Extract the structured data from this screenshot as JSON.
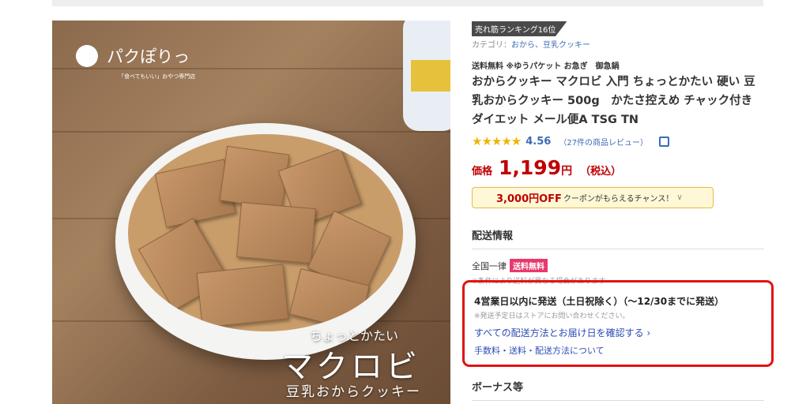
{
  "image": {
    "brand_name": "パクぽりっ",
    "brand_sub": "「食べてもいい」おやつ専門店",
    "overlay_small": "ちょっとかたい",
    "overlay_big": "マクロビ",
    "overlay_sub": "豆乳おからクッキー"
  },
  "product": {
    "ranking": "売れ筋ランキング16位",
    "category_label": "カテゴリ：",
    "category_links": "おから、豆乳クッキー",
    "shipping_tags": "送料無料 ※ゆうパケット お急ぎ　御急鍋",
    "title": "おからクッキー マクロビ 入門 ちょっとかたい 硬い 豆乳おからクッキー 500g　かたさ控えめ チャック付き ダイエット メール便A TSG TN",
    "stars": "★★★★★",
    "rating": "4.56",
    "reviews": "（27件の商品レビュー）",
    "price_label": "価格",
    "price": "1,199",
    "price_yen": "円",
    "price_tax": "（税込）",
    "coupon_amount": "3,000円OFF",
    "coupon_text": "クーポンがもらえるチャンス！",
    "coupon_chevron": "∨"
  },
  "shipping": {
    "heading": "配送情報",
    "nationwide": "全国一律",
    "free_badge": "送料無料",
    "note": "※条件により送料が異なる場合があります",
    "delivery_main": "4営業日以内に発送（土日祝除く）（～12/30までに発送）",
    "delivery_note": "※発送予定日はストアにお問い合わせください。",
    "link_methods": "すべての配送方法とお届け日を確認する ›",
    "link_fees": "手数料・送料・配送方法について"
  },
  "bonus": {
    "heading": "ボーナス等"
  }
}
